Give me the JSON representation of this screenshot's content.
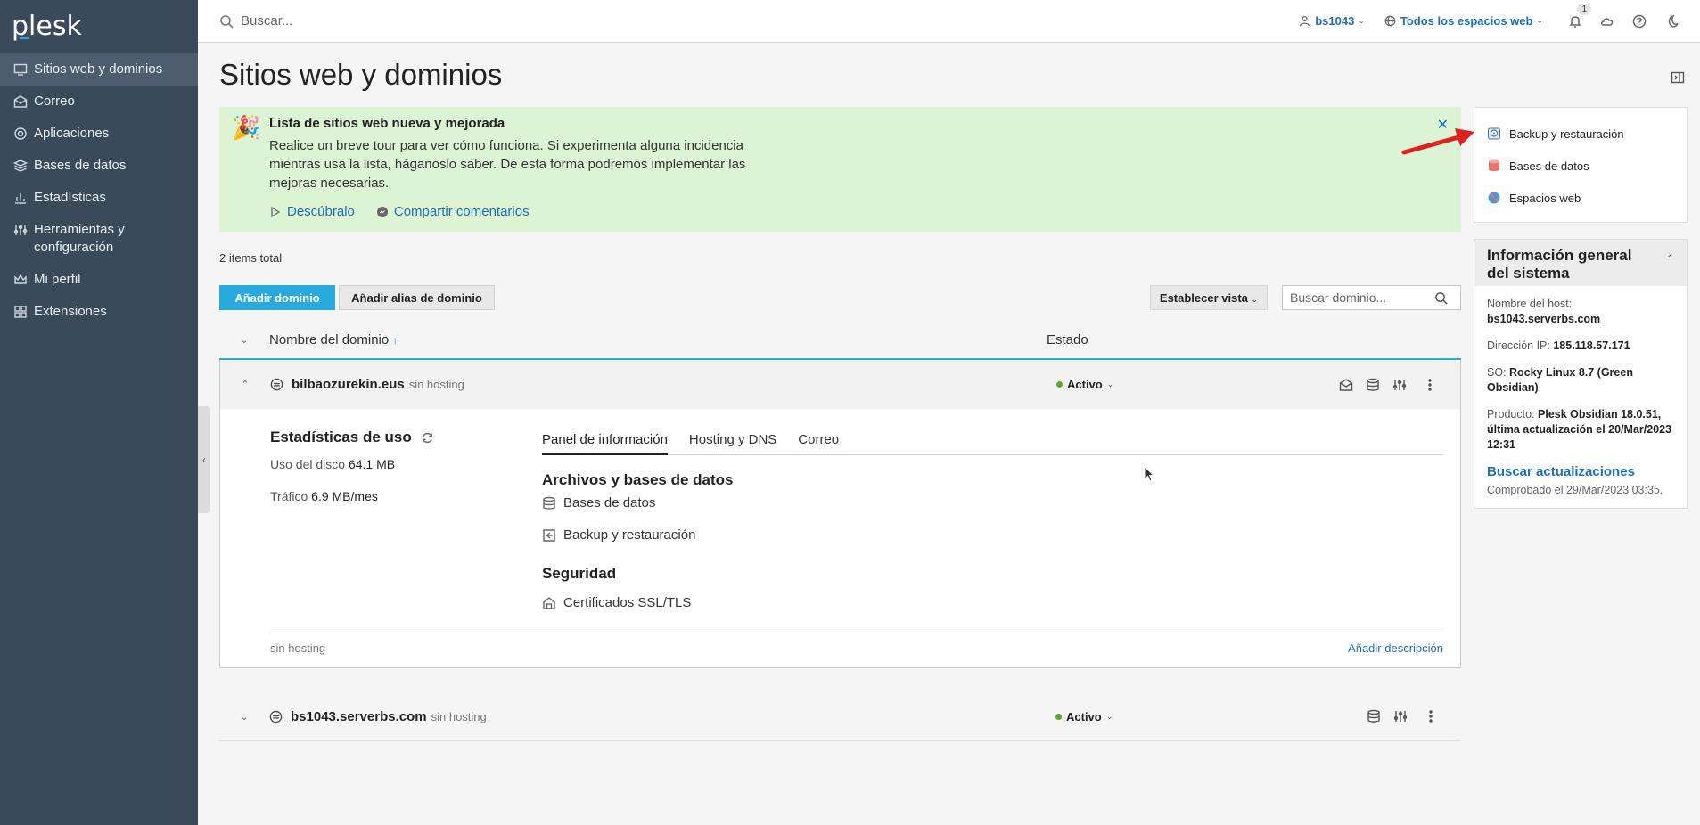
{
  "app": {
    "logo": "plesk"
  },
  "sidebar": {
    "items": [
      {
        "label": "Sitios web y dominios",
        "icon": "monitor-icon",
        "active": true
      },
      {
        "label": "Correo",
        "icon": "mail-icon"
      },
      {
        "label": "Aplicaciones",
        "icon": "gear-icon"
      },
      {
        "label": "Bases de datos",
        "icon": "layers-icon"
      },
      {
        "label": "Estadísticas",
        "icon": "bar-chart-icon"
      },
      {
        "label": "Herramientas y configuración",
        "icon": "sliders-icon"
      },
      {
        "label": "Mi perfil",
        "icon": "crown-icon"
      },
      {
        "label": "Extensiones",
        "icon": "puzzle-icon"
      }
    ]
  },
  "topbar": {
    "search_placeholder": "Buscar...",
    "user": "bs1043",
    "subscriptions": "Todos los espacios web",
    "notifications_count": "1"
  },
  "page": {
    "title": "Sitios web y dominios",
    "items_total": "2 items total"
  },
  "banner": {
    "title": "Lista de sitios web nueva y mejorada",
    "text": "Realice un breve tour para ver cómo funciona. Si experimenta alguna incidencia mientras usa la lista, háganoslo saber. De esta forma podremos implementar las mejoras necesarias.",
    "link_tour": "Descúbralo",
    "link_feedback": "Compartir comentarios"
  },
  "toolbar": {
    "add_domain": "Añadir dominio",
    "add_alias": "Añadir alias de dominio",
    "set_view": "Establecer vista",
    "domain_search_placeholder": "Buscar dominio..."
  },
  "table": {
    "col_name": "Nombre del dominio",
    "col_state": "Estado",
    "rows": [
      {
        "name": "bilbaozurekin.eus",
        "sub": "sin hosting",
        "status": "Activo",
        "usage_title": "Estadísticas de uso",
        "disk_label": "Uso del disco",
        "disk_value": "64.1 MB",
        "traffic_label": "Tráfico",
        "traffic_value": "6.9 MB/mes",
        "tabs": [
          "Panel de información",
          "Hosting y DNS",
          "Correo"
        ],
        "section_files": "Archivos y bases de datos",
        "item_db": "Bases de datos",
        "item_backup": "Backup y restauración",
        "section_security": "Seguridad",
        "item_ssl": "Certificados SSL/TLS",
        "footer_left": "sin hosting",
        "footer_right": "Añadir descripción"
      },
      {
        "name": "bs1043.serverbs.com",
        "sub": "sin hosting",
        "status": "Activo"
      }
    ]
  },
  "quick_links": [
    {
      "label": "Backup y restauración"
    },
    {
      "label": "Bases de datos"
    },
    {
      "label": "Espacios web"
    }
  ],
  "system_info": {
    "title": "Información general del sistema",
    "host_label": "Nombre del host:",
    "host_value": "bs1043.serverbs.com",
    "ip_label": "Dirección IP:",
    "ip_value": "185.118.57.171",
    "os_label": "SO:",
    "os_value": "Rocky Linux 8.7 (Green Obsidian)",
    "product_label": "Producto:",
    "product_value": "Plesk Obsidian 18.0.51, última actualización el 20/Mar/2023 12:31",
    "check_updates": "Buscar actualizaciones",
    "checked": "Comprobado el 29/Mar/2023 03:35."
  }
}
